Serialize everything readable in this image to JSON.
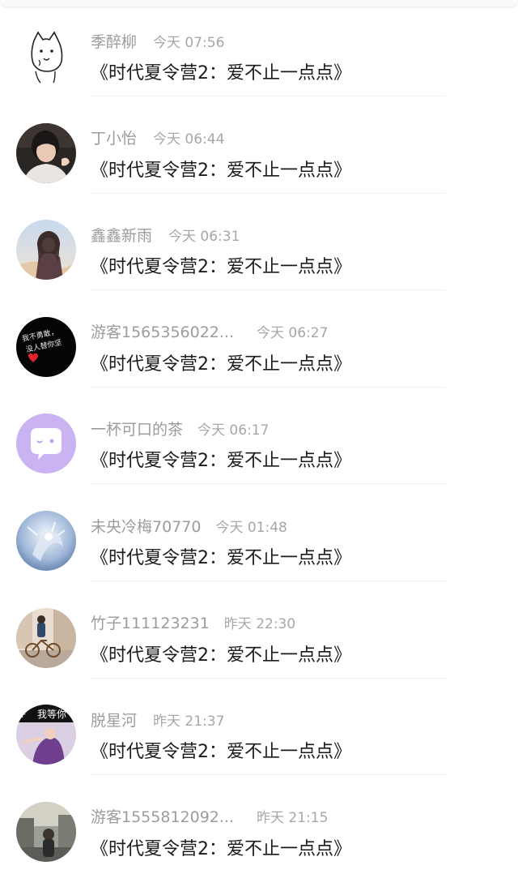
{
  "comments": [
    {
      "name": "季醉柳",
      "time": "今天 07:56",
      "text": "《时代夏令营2：爱不止一点点》",
      "avatar": "cartoon-dog-avatar",
      "time_gap": 20
    },
    {
      "name": "丁小怡",
      "time": "今天 06:44",
      "text": "《时代夏令营2：爱不止一点点》",
      "avatar": "selfie-photo-avatar",
      "time_gap": 20
    },
    {
      "name": "鑫鑫新雨",
      "time": "今天 06:31",
      "text": "《时代夏令营2：爱不止一点点》",
      "avatar": "anime-girl-avatar",
      "time_gap": 20
    },
    {
      "name": "游客1565356022...",
      "time": "今天 06:27",
      "text": "《时代夏令营2：爱不止一点点》",
      "avatar": "black-text-heart-avatar",
      "time_gap": 28
    },
    {
      "name": "一杯可口的茶",
      "time": "今天 06:17",
      "text": "《时代夏令营2：爱不止一点点》",
      "avatar": "purple-chat-bubble-avatar",
      "time_gap": 18
    },
    {
      "name": "未央冷梅70770",
      "time": "今天 01:48",
      "text": "《时代夏令营2：爱不止一点点》",
      "avatar": "blue-fantasy-avatar",
      "time_gap": 18
    },
    {
      "name": "竹子111123231",
      "time": "昨天 22:30",
      "text": "《时代夏令营2：爱不止一点点》",
      "avatar": "bicycle-street-avatar",
      "time_gap": 18
    },
    {
      "name": "脱星河",
      "time": "昨天 21:37",
      "text": "《时代夏令营2：爱不止一点点》",
      "avatar": "wait-for-you-avatar",
      "time_gap": 20
    },
    {
      "name": "游客1555812092...",
      "time": "昨天 21:15",
      "text": "《时代夏令营2：爱不止一点点》",
      "avatar": "city-street-avatar",
      "time_gap": 28
    }
  ],
  "avatar_art": {
    "wait_for_you_text": "我等你",
    "wait_for_you_letter": "F",
    "black_avatar_lines": [
      "我不勇敢，",
      "没人替你坚"
    ]
  },
  "colors": {
    "name_text": "#9c9c9c",
    "time_text": "#a7a7a7",
    "message_text": "#1b1b1b",
    "divider": "#efefef",
    "chat_bubble_bg": "#c9b3f2"
  }
}
